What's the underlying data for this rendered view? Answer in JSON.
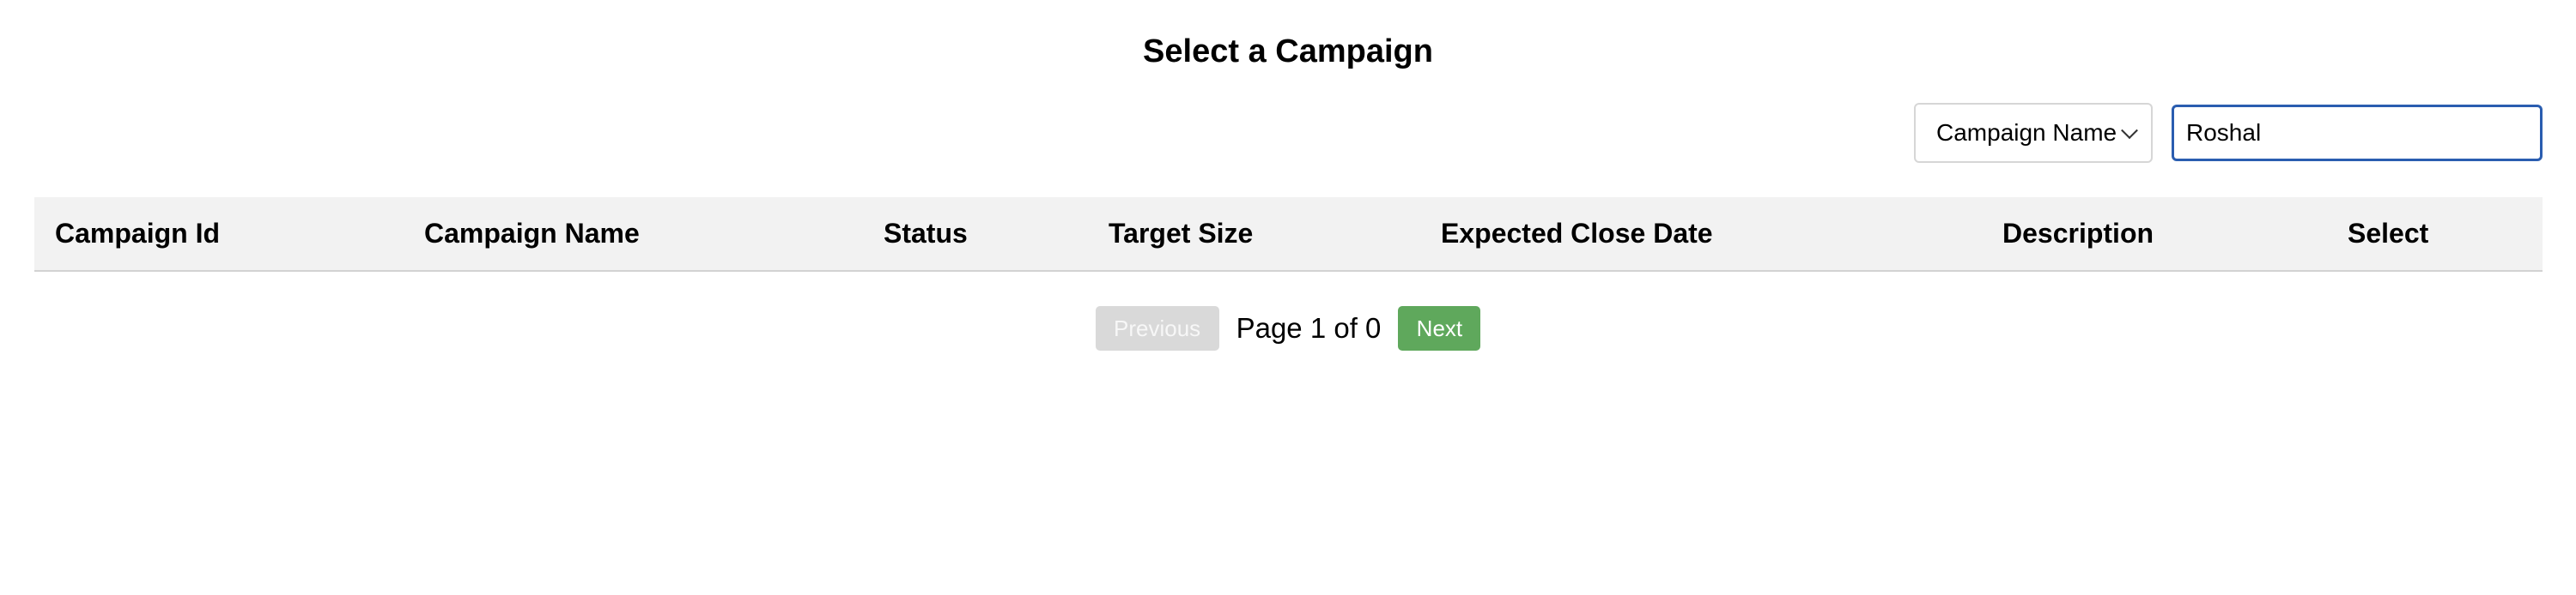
{
  "header": {
    "title": "Select a Campaign"
  },
  "filter": {
    "field_selected": "Campaign Name",
    "search_value": "Roshal"
  },
  "table": {
    "columns": [
      "Campaign Id",
      "Campaign Name",
      "Status",
      "Target Size",
      "Expected Close Date",
      "Description",
      "Select"
    ],
    "rows": []
  },
  "pagination": {
    "previous_label": "Previous",
    "page_info": "Page 1 of 0",
    "next_label": "Next"
  },
  "colors": {
    "next_button": "#5fa85c",
    "previous_button_disabled": "#d9d9d9",
    "header_bg": "#f2f2f2",
    "input_focus_border": "#2a5db0"
  }
}
